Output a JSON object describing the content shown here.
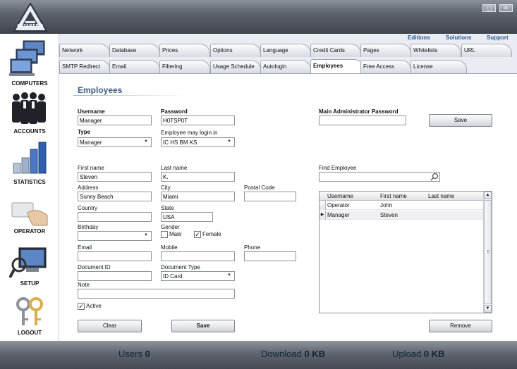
{
  "app": {
    "logo_text": "ANTAMEDIA",
    "window_buttons": [
      "▢",
      "✕"
    ]
  },
  "top_links": [
    "Editions",
    "Solutions",
    "Support"
  ],
  "sidebar": {
    "items": [
      {
        "label": "COMPUTERS",
        "icon": "computers-icon"
      },
      {
        "label": "ACCOUNTS",
        "icon": "accounts-icon"
      },
      {
        "label": "STATISTICS",
        "icon": "statistics-icon"
      },
      {
        "label": "OPERATOR",
        "icon": "operator-icon"
      },
      {
        "label": "SETUP",
        "icon": "setup-icon"
      },
      {
        "label": "LOGOUT",
        "icon": "logout-icon"
      }
    ]
  },
  "tabs": {
    "row1": [
      "Network",
      "Database",
      "Prices",
      "Options",
      "Language",
      "Credit Cards",
      "Pages",
      "Whitelists",
      "URL"
    ],
    "row2": [
      "SMTP Redirect",
      "Email",
      "Filtering",
      "Usage Schedule",
      "Autologin",
      "Employees",
      "Free Access",
      "License"
    ],
    "active": "Employees"
  },
  "page": {
    "title": "Employees"
  },
  "form": {
    "username": {
      "label": "Username",
      "value": "Manager"
    },
    "password": {
      "label": "Password",
      "value": "H0TSP0T"
    },
    "type": {
      "label": "Type",
      "value": "Manager"
    },
    "login_in": {
      "label": "Employee may login in",
      "value": "IC HS BM KS"
    },
    "main_admin_password": {
      "label": "Main Administrator Password",
      "value": ""
    },
    "first_name": {
      "label": "First name",
      "value": "Steven"
    },
    "last_name": {
      "label": "Last name",
      "value": "K."
    },
    "address": {
      "label": "Address",
      "value": "Sunny Beach"
    },
    "city": {
      "label": "City",
      "value": "Miami"
    },
    "postal_code": {
      "label": "Postal Code",
      "value": ""
    },
    "country": {
      "label": "Country",
      "value": ""
    },
    "state": {
      "label": "State",
      "value": "USA"
    },
    "birthday": {
      "label": "Birthday",
      "value": ""
    },
    "gender": {
      "label": "Gender",
      "male": "Male",
      "female": "Female",
      "male_checked": false,
      "female_checked": true
    },
    "email": {
      "label": "Email",
      "value": ""
    },
    "mobile": {
      "label": "Mobile",
      "value": ""
    },
    "phone": {
      "label": "Phone",
      "value": ""
    },
    "document_id": {
      "label": "Document ID",
      "value": ""
    },
    "document_type": {
      "label": "Document Type",
      "value": "ID Card"
    },
    "note": {
      "label": "Note",
      "value": ""
    },
    "active": {
      "label": "Active",
      "checked": true
    },
    "find_employee": {
      "label": "Find Employee",
      "value": ""
    }
  },
  "buttons": {
    "save_admin": "Save",
    "clear": "Clear",
    "save": "Save",
    "remove": "Remove"
  },
  "table": {
    "columns": [
      "Username",
      "First name",
      "Last name"
    ],
    "rows": [
      {
        "username": "Operator",
        "first_name": "John",
        "last_name": ""
      },
      {
        "username": "Manager",
        "first_name": "Steven",
        "last_name": ""
      }
    ]
  },
  "status": {
    "users_label": "Users",
    "users_value": "0",
    "download_label": "Download",
    "download_value": "0 KB",
    "upload_label": "Upload",
    "upload_value": "0 KB"
  }
}
